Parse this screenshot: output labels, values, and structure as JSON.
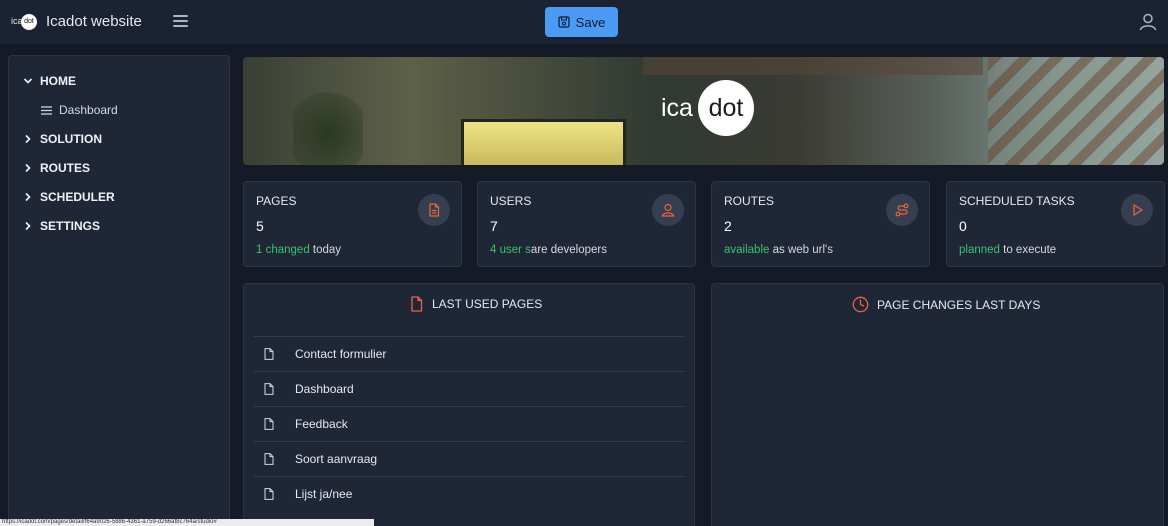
{
  "header": {
    "logo": {
      "ica": "ica",
      "dot": "dot"
    },
    "title": "Icadot website",
    "save_label": "Save"
  },
  "sidebar": {
    "items": [
      {
        "label": "HOME",
        "expanded": true,
        "children": [
          {
            "label": "Dashboard"
          }
        ]
      },
      {
        "label": "SOLUTION",
        "expanded": false
      },
      {
        "label": "ROUTES",
        "expanded": false
      },
      {
        "label": "SCHEDULER",
        "expanded": false
      },
      {
        "label": "SETTINGS",
        "expanded": false
      }
    ]
  },
  "hero": {
    "logo": {
      "ica": "ica",
      "dot": "dot"
    }
  },
  "cards": [
    {
      "label": "PAGES",
      "value": "5",
      "highlight": "1 changed",
      "rest": " today",
      "icon": "file-icon"
    },
    {
      "label": "USERS",
      "value": "7",
      "highlight": "4 user s",
      "rest": "are developers",
      "icon": "user-icon"
    },
    {
      "label": "ROUTES",
      "value": "2",
      "highlight": "available",
      "rest": " as web url's",
      "icon": "route-icon"
    },
    {
      "label": "SCHEDULED TASKS",
      "value": "0",
      "highlight": "planned",
      "rest": " to execute",
      "icon": "play-icon"
    }
  ],
  "last_used": {
    "title": "LAST USED PAGES",
    "items": [
      "Contact formulier",
      "Dashboard",
      "Feedback",
      "Soort aanvraag",
      "Lijst ja/nee"
    ]
  },
  "page_changes": {
    "title": "PAGE CHANGES LAST DAYS"
  },
  "statusbar": {
    "url": "https://icadot.com/pages/detail/f64a9026-5886-4361-a759-d266af8c764a/studio#"
  },
  "colors": {
    "accent": "#4b9bf5",
    "orange": "#e8643c",
    "green": "#39c26b"
  }
}
